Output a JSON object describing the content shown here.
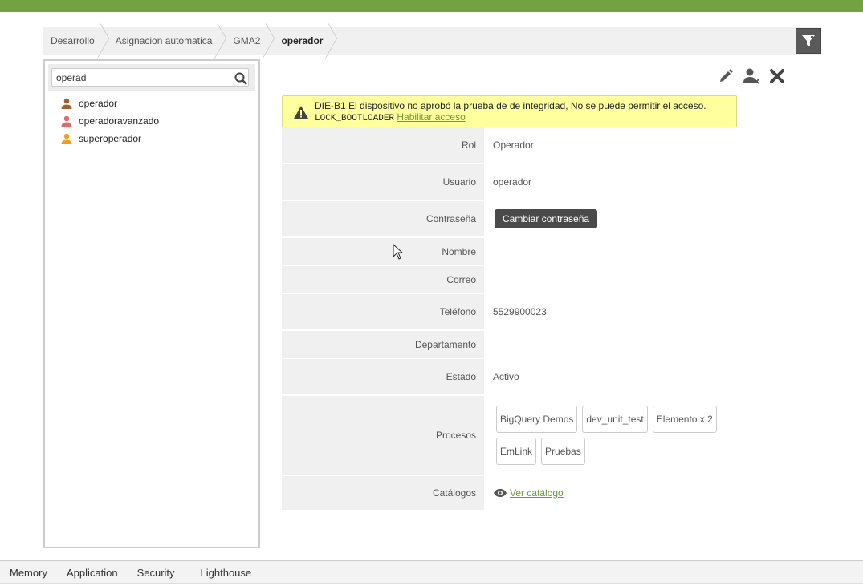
{
  "breadcrumb": [
    "Desarrollo",
    "Asignacion automatica",
    "GMA2",
    "operador"
  ],
  "search": {
    "value": "operad"
  },
  "tree": [
    {
      "label": "operador",
      "color": "#a0602a"
    },
    {
      "label": "operadoravanzado",
      "color": "#e06a6a"
    },
    {
      "label": "superoperador",
      "color": "#f0a020"
    }
  ],
  "warning": {
    "message": "DIE-B1 El dispositivo no aprobó la prueba de de integridad, No se puede permitir el acceso.",
    "code": "LOCK_BOOTLOADER",
    "link": "Habilitar acceso"
  },
  "detail": {
    "rol": {
      "label": "Rol",
      "value": "Operador"
    },
    "usuario": {
      "label": "Usuario",
      "value": "operador"
    },
    "contrasena": {
      "label": "Contraseña",
      "button": "Cambiar contraseña"
    },
    "nombre": {
      "label": "Nombre",
      "value": ""
    },
    "correo": {
      "label": "Correo",
      "value": ""
    },
    "telefono": {
      "label": "Teléfono",
      "value": "5529900023"
    },
    "departamento": {
      "label": "Departamento",
      "value": ""
    },
    "estado": {
      "label": "Estado",
      "value": "Activo"
    },
    "procesos": {
      "label": "Procesos",
      "items": [
        "BigQuery Demos",
        "dev_unit_test",
        "Elemento x 2",
        "EmLink",
        "Pruebas"
      ]
    },
    "catalogos": {
      "label": "Catálogos",
      "link": "Ver catálogo"
    }
  },
  "devtools": {
    "tabs": [
      "Memory",
      "Application",
      "Security",
      "Lighthouse"
    ]
  },
  "colors": {
    "accent": "#72a340",
    "warning_bg": "#ffff9e"
  }
}
